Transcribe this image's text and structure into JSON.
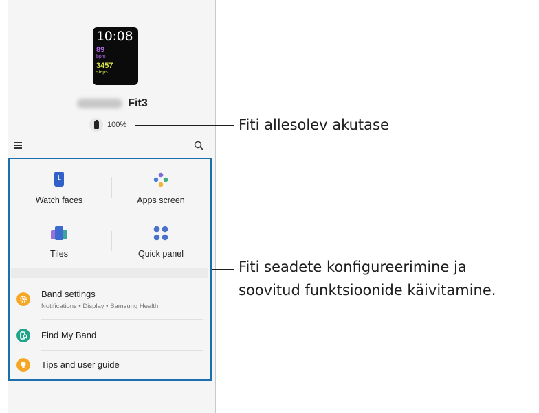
{
  "watch": {
    "time": "10:08",
    "heart_rate": "89",
    "heart_unit": "bpm",
    "steps": "3457",
    "steps_unit": "steps"
  },
  "device": {
    "name_suffix": "Fit3"
  },
  "battery": {
    "level_text": "100%"
  },
  "grid": [
    {
      "label": "Watch faces",
      "icon": "watch-face-icon"
    },
    {
      "label": "Apps screen",
      "icon": "apps-screen-icon"
    },
    {
      "label": "Tiles",
      "icon": "tiles-icon"
    },
    {
      "label": "Quick panel",
      "icon": "quick-panel-icon"
    }
  ],
  "list": [
    {
      "title": "Band settings",
      "subtitle": "Notifications • Display • Samsung Health",
      "icon": "gear-icon",
      "color": "#f5a623"
    },
    {
      "title": "Find My Band",
      "subtitle": "",
      "icon": "find-band-icon",
      "color": "#1fa38a"
    },
    {
      "title": "Tips and user guide",
      "subtitle": "",
      "icon": "bulb-icon",
      "color": "#f5a623"
    }
  ],
  "callouts": {
    "battery": "Fiti allesolev akutase",
    "settings_line1": "Fiti seadete konfigureerimine ja",
    "settings_line2": "soovitud funktsioonide käivitamine."
  },
  "colors": {
    "highlight_border": "#1b6fad",
    "watch_purple": "#b267e6",
    "watch_yellow": "#d8e24a"
  }
}
